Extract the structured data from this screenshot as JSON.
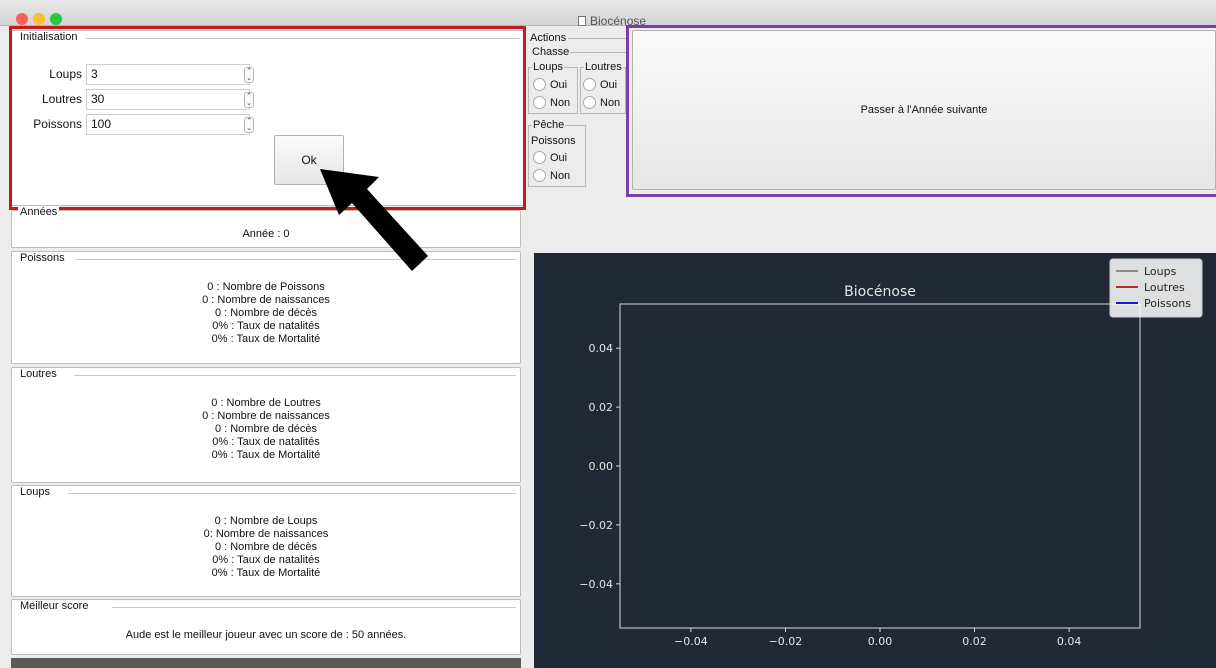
{
  "window": {
    "title": "Biocénose"
  },
  "colors": {
    "highlight_red": "#c41a1a",
    "highlight_purple": "#7b3ea8",
    "chart_bg": "#212836",
    "arrow": "#000000"
  },
  "init": {
    "title": "Initialisation",
    "fields": [
      {
        "label": "Loups",
        "value": "3"
      },
      {
        "label": "Loutres",
        "value": "30"
      },
      {
        "label": "Poissons",
        "value": "100"
      }
    ],
    "ok_label": "Ok"
  },
  "actions": {
    "title": "Actions",
    "chasse": {
      "title": "Chasse",
      "loups": "Loups",
      "loutres": "Loutres"
    },
    "peche": {
      "title": "Pêche",
      "poissons": "Poissons"
    },
    "oui": "Oui",
    "non": "Non"
  },
  "next_button": "Passer à l'Année suivante",
  "annees": {
    "title": "Années",
    "value": "Année : 0"
  },
  "poissons": {
    "title": "Poissons",
    "lines": [
      "0 : Nombre de Poissons",
      "0 : Nombre de naissances",
      "0 : Nombre de décès",
      "0% : Taux de natalités",
      "0% : Taux de Mortalité"
    ]
  },
  "loutres": {
    "title": "Loutres",
    "lines": [
      "0 : Nombre de Loutres",
      "0 : Nombre de naissances",
      "0 : Nombre de décès",
      "0% : Taux de natalités",
      "0% : Taux de Mortalité"
    ]
  },
  "loups": {
    "title": "Loups",
    "lines": [
      "0 : Nombre de Loups",
      "0: Nombre de naissances",
      "0 : Nombre de décès",
      "0% : Taux de natalités",
      "0% : Taux de Mortalité"
    ]
  },
  "score": {
    "title": "Meilleur score",
    "text": "Aude est le meilleur joueur avec un score de : 50 années."
  },
  "chart_data": {
    "type": "line",
    "title": "Biocénose",
    "xlabel": "",
    "ylabel": "",
    "xlim": [
      -0.055,
      0.055
    ],
    "ylim": [
      -0.055,
      0.055
    ],
    "x_ticks": [
      "−0.04",
      "−0.02",
      "0.00",
      "0.02",
      "0.04"
    ],
    "x_tick_values": [
      -0.04,
      -0.02,
      0.0,
      0.02,
      0.04
    ],
    "y_ticks": [
      "0.04",
      "0.02",
      "0.00",
      "−0.02",
      "−0.04"
    ],
    "y_tick_values": [
      0.04,
      0.02,
      0.0,
      -0.02,
      -0.04
    ],
    "grid": false,
    "legend_position": "top-right",
    "series": [
      {
        "name": "Loups",
        "color": "#8c8c8c",
        "values": []
      },
      {
        "name": "Loutres",
        "color": "#c0262d",
        "values": []
      },
      {
        "name": "Poissons",
        "color": "#1515e6",
        "values": []
      }
    ]
  }
}
